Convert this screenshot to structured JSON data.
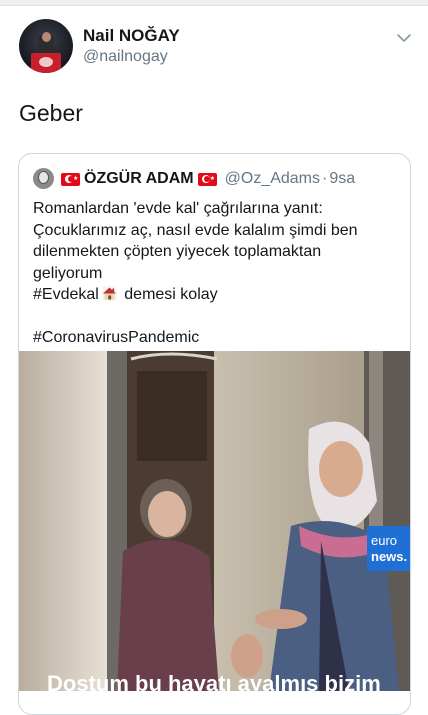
{
  "author": {
    "name": "Nail NOĞAY",
    "handle": "@nailnogay"
  },
  "tweet": {
    "text": "Geber"
  },
  "quoted": {
    "name": "ÖZGÜR ADAM",
    "handle": "@Oz_Adams",
    "separator": "·",
    "time": "9sa",
    "lines": [
      "Romanlardan 'evde kal' çağrılarına yanıt:",
      "Çocuklarımız aç, nasıl evde kalalım şimdi ben",
      "dilenmekten çöpten yiyecek toplamaktan",
      "geliyorum"
    ],
    "hashtag_line": {
      "hashtag": "#Evdekal",
      "after": "demesi kolay"
    },
    "hashtag2": "#CoronavirusPandemic",
    "media": {
      "logo_line1": "euro",
      "logo_line2": "news.",
      "caption_partial": "Dostum bu hayatı ayalmış bizim"
    }
  },
  "colors": {
    "text": "#14171a",
    "secondary": "#657786",
    "border": "#ccd6dd",
    "flag": "#e30a17",
    "euronews": "#1f6fd4"
  },
  "icons": [
    "chevron-down-icon",
    "turkish-flag-icon",
    "house-icon"
  ]
}
